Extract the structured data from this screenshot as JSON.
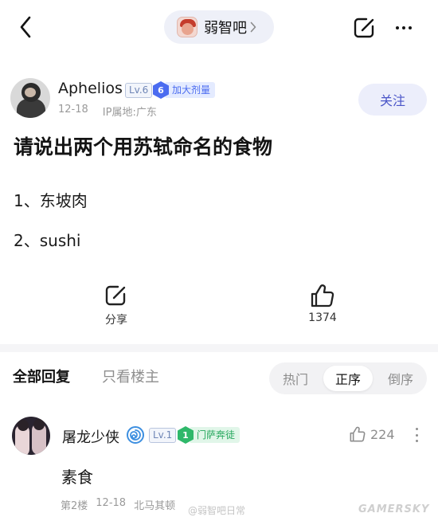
{
  "header": {
    "forum_name": "弱智吧"
  },
  "author": {
    "name": "Aphelios",
    "level": "Lv.6",
    "fan_level": "6",
    "fan_title": "加大剂量",
    "date": "12-18",
    "ip_location": "IP属地:广东",
    "follow_label": "关注"
  },
  "post": {
    "title": "请说出两个用苏轼命名的食物",
    "lines": [
      "1、东坡肉",
      "2、sushi"
    ]
  },
  "actions": {
    "share_label": "分享",
    "like_count": "1374"
  },
  "replies_header": {
    "tab_all": "全部回复",
    "tab_op_only": "只看楼主",
    "sort_options": [
      "热门",
      "正序",
      "倒序"
    ],
    "sort_selected": "正序"
  },
  "reply": {
    "name": "屠龙少侠",
    "level": "Lv.1",
    "fan_level": "1",
    "fan_title": "门萨奔徒",
    "like_count": "224",
    "body": "素食",
    "floor": "第2楼",
    "date": "12-18",
    "location": "北马其顿"
  },
  "watermarks": {
    "weibo": "@弱智吧日常",
    "site": "GAMERSKY"
  },
  "colors": {
    "accent_blue": "#4b6cf0",
    "follow_text": "#4a55c8",
    "green_badge": "#2fb86a"
  },
  "icons": [
    "back-arrow-icon",
    "chevron-right-icon",
    "share-icon",
    "more-icon",
    "thumbs-up-icon",
    "swirl-icon"
  ]
}
